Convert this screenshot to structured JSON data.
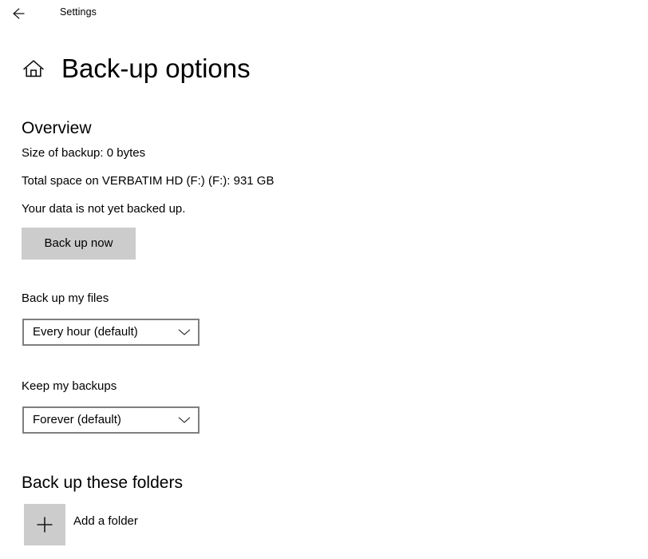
{
  "titlebar": {
    "back_icon": "back-arrow-icon",
    "app_title": "Settings"
  },
  "header": {
    "home_icon": "home-icon",
    "page_title": "Back-up options"
  },
  "overview": {
    "heading": "Overview",
    "size_of_backup": "Size of backup: 0 bytes",
    "total_space": "Total space on VERBATIM HD (F:) (F:): 931 GB",
    "status": "Your data is not yet backed up.",
    "backup_now_button": "Back up now"
  },
  "backup_frequency": {
    "label": "Back up my files",
    "selected": "Every hour (default)",
    "chevron_icon": "chevron-down-icon"
  },
  "backup_retention": {
    "label": "Keep my backups",
    "selected": "Forever (default)",
    "chevron_icon": "chevron-down-icon"
  },
  "folders": {
    "heading": "Back up these folders",
    "add_icon": "plus-icon",
    "add_label": "Add a folder"
  },
  "colors": {
    "page_background": "#ffffff",
    "text": "#000000",
    "button_fill": "#cccccc",
    "combo_border": "#7f7f7f"
  }
}
